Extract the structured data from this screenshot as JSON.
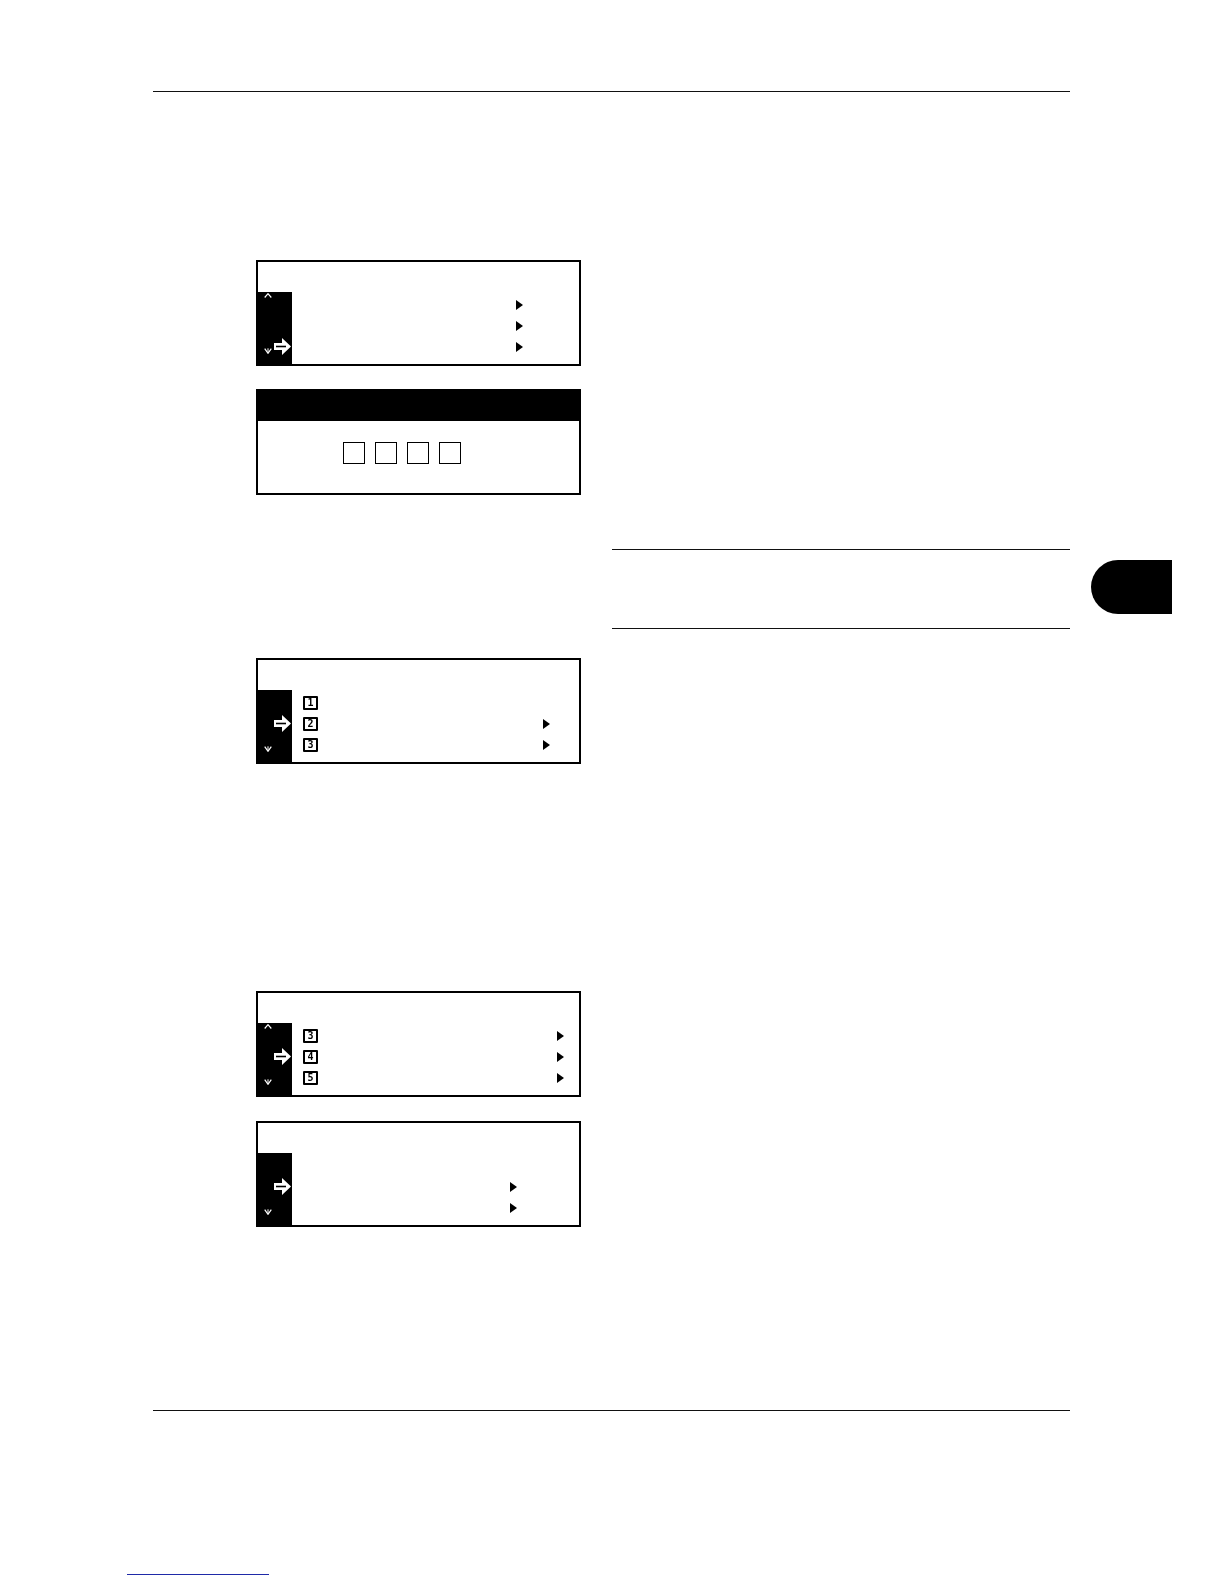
{
  "screens": [
    {
      "kind": "menu",
      "scroll_up": true,
      "scroll_down": true,
      "rows": [
        {
          "selected": false,
          "submenu": true
        },
        {
          "selected": false,
          "submenu": true
        },
        {
          "selected": true,
          "submenu": true
        }
      ]
    },
    {
      "kind": "code_entry",
      "digits": [
        {
          "filled": false
        },
        {
          "filled": false
        },
        {
          "filled": false
        },
        {
          "filled": false
        }
      ]
    },
    {
      "kind": "menu",
      "scroll_up": false,
      "scroll_down": true,
      "rows": [
        {
          "number": "1",
          "selected": false,
          "submenu": false
        },
        {
          "number": "2",
          "selected": true,
          "submenu": true
        },
        {
          "number": "3",
          "selected": false,
          "submenu": true
        }
      ]
    },
    {
      "kind": "menu",
      "scroll_up": true,
      "scroll_down": true,
      "rows": [
        {
          "number": "3",
          "selected": false,
          "submenu": true
        },
        {
          "number": "4",
          "selected": true,
          "submenu": true
        },
        {
          "number": "5",
          "selected": false,
          "submenu": true
        }
      ]
    },
    {
      "kind": "menu",
      "scroll_up": false,
      "scroll_down": true,
      "rows": [
        {
          "selected": false,
          "submenu": false
        },
        {
          "selected": true,
          "submenu": true
        },
        {
          "selected": false,
          "submenu": true
        }
      ]
    }
  ]
}
